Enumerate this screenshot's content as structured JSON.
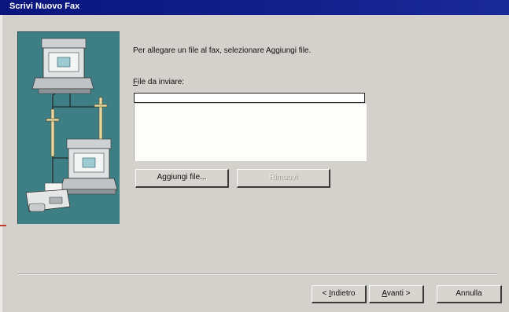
{
  "window": {
    "title": "Scrivi Nuovo Fax"
  },
  "content": {
    "instruction": "Per allegare un file al fax, selezionare Aggiungi file.",
    "file_label": "File da inviare:",
    "file_label_rest": "ile da inviare:",
    "file_label_key": "F",
    "file_input_value": ""
  },
  "buttons": {
    "add_label_pre": "A",
    "add_label_key": "g",
    "add_label_post": "giungi file...",
    "remove_label": "Rimuovi",
    "back_label_pre": "< ",
    "back_label_key": "I",
    "back_label_post": "ndietro",
    "next_label_key": "A",
    "next_label_post": "vanti >",
    "cancel_label": "Annulla"
  },
  "illustration": {
    "name": "fax-network-illustration"
  }
}
